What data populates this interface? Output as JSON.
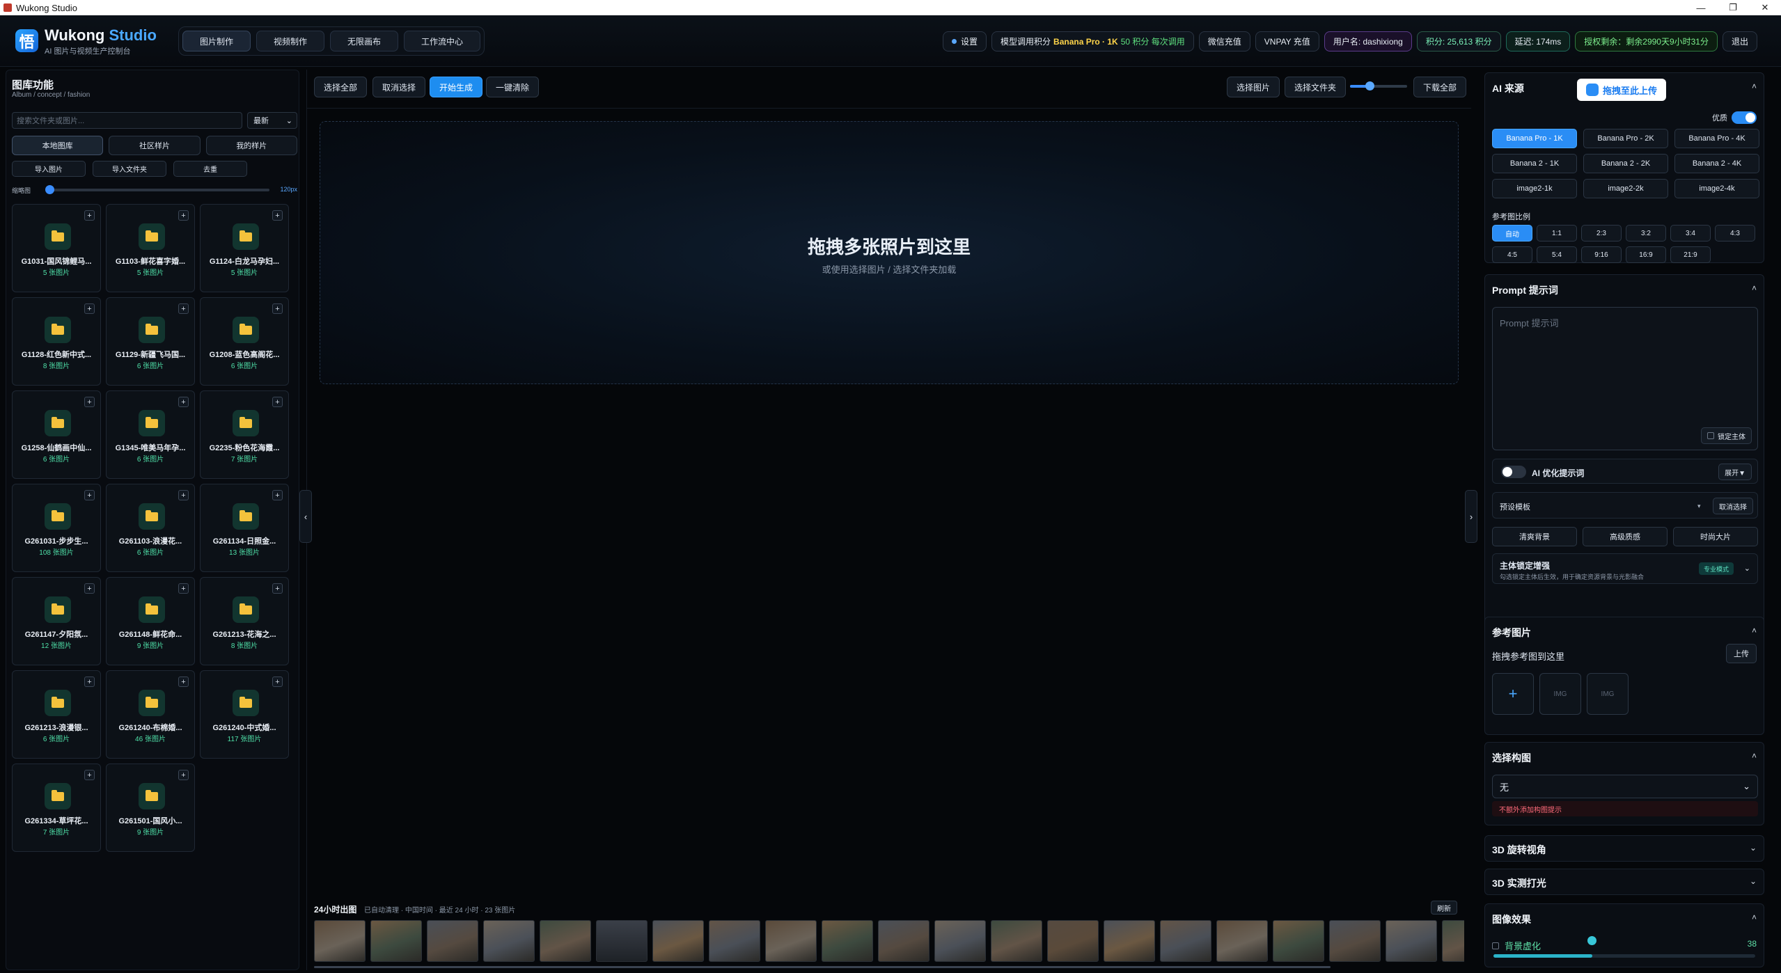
{
  "window": {
    "title": "Wukong Studio",
    "controls": [
      "—",
      "❐",
      "✕"
    ]
  },
  "header": {
    "logo_char": "悟",
    "brand_main": "Wukong",
    "brand_accent": "Studio",
    "brand_sub": "AI 图片与视频生产控制台",
    "nav": [
      "图片制作",
      "视频制作",
      "无限画布",
      "工作流中心"
    ],
    "settings": "设置",
    "model_cost_prefix": "模型调用积分",
    "model_cost_model": "Banana Pro · 1K",
    "model_cost_suffix": "50 积分 每次调用",
    "wechat": "微信充值",
    "vnpay": "VNPAY 充值",
    "user": "用户名: dashixiong",
    "points": "积分: 25,613 积分",
    "latency": "延迟: 174ms",
    "license": "授权剩余：剩余2990天9小时31分",
    "logout": "退出"
  },
  "left": {
    "title": "图库功能",
    "subtitle": "Album / concept / fashion",
    "search_placeholder": "搜索文件夹或图片...",
    "sort": "最新",
    "tabs": [
      "本地图库",
      "社区样片",
      "我的样片"
    ],
    "actions": [
      "导入图片",
      "导入文件夹",
      "去重"
    ],
    "thumb_label": "缩略图",
    "thumb_value": "120px",
    "folders": [
      {
        "name": "G1031-国风锦鲤马...",
        "count": "5 张图片"
      },
      {
        "name": "G1103-鲜花喜字婚...",
        "count": "5 张图片"
      },
      {
        "name": "G1124-白龙马孕妇...",
        "count": "5 张图片"
      },
      {
        "name": "G1128-红色新中式...",
        "count": "8 张图片"
      },
      {
        "name": "G1129-新疆飞马国...",
        "count": "6 张图片"
      },
      {
        "name": "G1208-蓝色高阁花...",
        "count": "6 张图片"
      },
      {
        "name": "G1258-仙鹤画中仙...",
        "count": "6 张图片"
      },
      {
        "name": "G1345-唯美马年孕...",
        "count": "6 张图片"
      },
      {
        "name": "G2235-粉色花海霞...",
        "count": "7 张图片"
      },
      {
        "name": "G261031-步步生...",
        "count": "108 张图片"
      },
      {
        "name": "G261103-浪漫花...",
        "count": "6 张图片"
      },
      {
        "name": "G261134-日照金...",
        "count": "13 张图片"
      },
      {
        "name": "G261147-夕阳氛...",
        "count": "12 张图片"
      },
      {
        "name": "G261148-鲜花命...",
        "count": "9 张图片"
      },
      {
        "name": "G261213-花海之...",
        "count": "8 张图片"
      },
      {
        "name": "G261213-浪漫银...",
        "count": "6 张图片"
      },
      {
        "name": "G261240-布棉婚...",
        "count": "46 张图片"
      },
      {
        "name": "G261240-中式婚...",
        "count": "117 张图片"
      },
      {
        "name": "G261334-草坪花...",
        "count": "7 张图片"
      },
      {
        "name": "G261501-国风小...",
        "count": "9 张图片"
      }
    ]
  },
  "center": {
    "toolbar_left": [
      "选择全部",
      "取消选择",
      "开始生成",
      "一键清除"
    ],
    "toolbar_right": [
      "选择图片",
      "选择文件夹",
      "下载全部"
    ],
    "drop_title": "拖拽多张照片到这里",
    "drop_sub": "或使用选择图片 / 选择文件夹加载",
    "recent_title": "24小时出图",
    "recent_meta": "已自动清理 · 中国时间 · 最近 24 小时 · 23 张图片",
    "refresh": "刷新",
    "recent_count": 21
  },
  "right": {
    "ai_source": "AI 来源",
    "upload_btn": "拖拽至此上传",
    "quality_label": "优质",
    "models": [
      "Banana Pro - 1K",
      "Banana Pro - 2K",
      "Banana Pro - 4K",
      "Banana 2 - 1K",
      "Banana 2 - 2K",
      "Banana 2 - 4K",
      "image2-1k",
      "image2-2k",
      "image2-4k"
    ],
    "ratio_label": "参考图比例",
    "ratios": [
      "自动",
      "1:1",
      "2:3",
      "3:2",
      "3:4",
      "4:3",
      "4:5",
      "5:4",
      "9:16",
      "16:9",
      "21:9"
    ],
    "prompt_title": "Prompt 提示词",
    "prompt_placeholder": "Prompt 提示词",
    "lock_subject": "锁定主体",
    "ai_optimize": "AI 优化提示词",
    "expand": "展开▼",
    "preset": "预设模板",
    "preset_cancel": "取消选择",
    "quick": [
      "清爽背景",
      "高级质感",
      "时尚大片"
    ],
    "subject_title": "主体锁定增强",
    "subject_desc": "勾选锁定主体后生效，用于确定资源背景与光影融合",
    "subject_badge": "专业模式",
    "ref_title": "参考图片",
    "ref_drop": "拖拽参考图到这里",
    "ref_upload": "上传",
    "ref_slot": "IMG",
    "comp_title": "选择构图",
    "comp_value": "无",
    "comp_warn": "不额外添加构图提示",
    "rot3d": "3D 旋转视角",
    "light3d": "3D 实测打光",
    "effect_title": "图像效果",
    "blur_label": "背景虚化",
    "blur_value": "38"
  },
  "colors": {
    "accent": "#2a8df5",
    "bg": "#05070a",
    "folder": "#f4c23c",
    "count": "#4fe0a8"
  }
}
